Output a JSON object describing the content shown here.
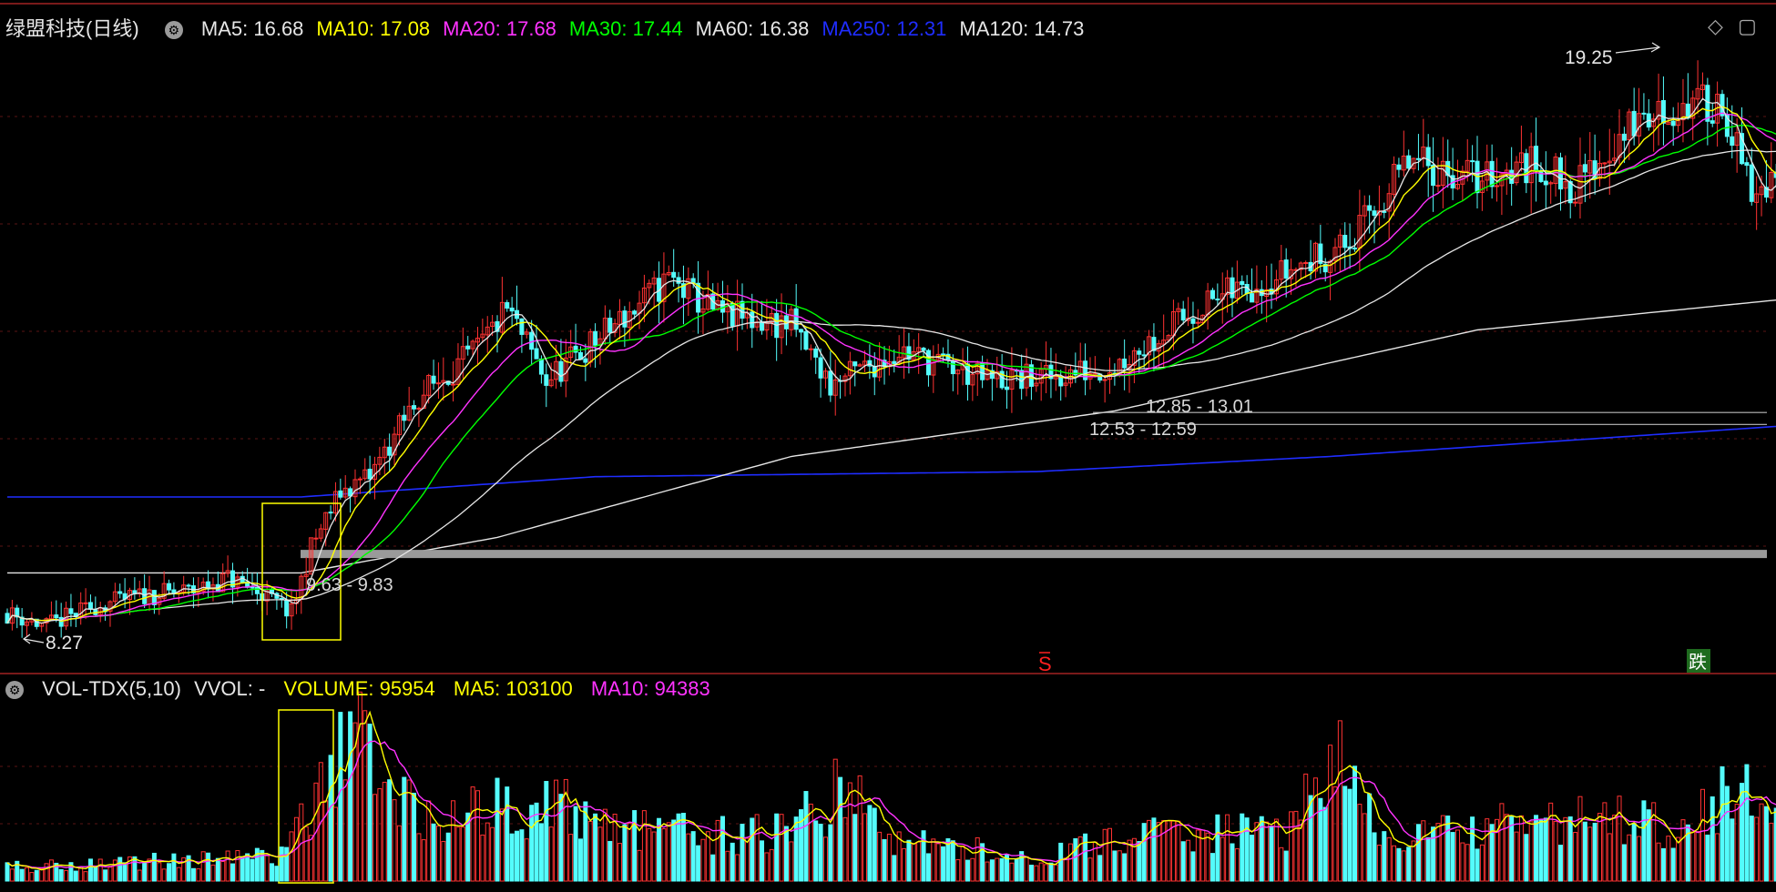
{
  "header": {
    "stock_title": "绿盟科技(日线)",
    "ma_values": [
      {
        "text": "MA5: 16.68",
        "color": "#e6e6e6"
      },
      {
        "text": "MA10: 17.08",
        "color": "#ffff00"
      },
      {
        "text": "MA20: 17.68",
        "color": "#ff33ff"
      },
      {
        "text": "MA30: 17.44",
        "color": "#00ff00"
      },
      {
        "text": "MA60: 16.38",
        "color": "#e6e6e6"
      },
      {
        "text": "MA250: 12.31",
        "color": "#1f2dff"
      },
      {
        "text": "MA120: 14.73",
        "color": "#e6e6e6"
      }
    ]
  },
  "volume_header": {
    "indicator": "VOL-TDX(5,10)",
    "vvol": "VVOL: -",
    "volume": "VOLUME: 95954",
    "ma5": "MA5: 103100",
    "ma10": "MA10: 94383"
  },
  "annotations": {
    "high_label": "19.25",
    "low_label": "8.27",
    "gap1": "9.63 - 9.83",
    "gap2": "12.85 - 13.01",
    "gap3": "12.53 - 12.59",
    "s_marker": "S",
    "die_marker": "跌"
  },
  "chart_data": {
    "type": "candlestick",
    "price_range": [
      7.5,
      20.0
    ],
    "colors": {
      "up": "#ff3232",
      "down": "#54fcfc",
      "ma5": "#e6e6e6",
      "ma10": "#ffff00",
      "ma20": "#ff33ff",
      "ma30": "#00ff00",
      "ma60": "#e6e6e6",
      "ma120": "#e6e6e6",
      "ma250": "#1f2dff"
    },
    "price_path": [
      [
        0,
        8.6
      ],
      [
        8,
        8.35
      ],
      [
        18,
        8.75
      ],
      [
        28,
        8.95
      ],
      [
        38,
        9.05
      ],
      [
        45,
        9.3
      ],
      [
        52,
        9.0
      ],
      [
        58,
        8.6
      ],
      [
        62,
        9.9
      ],
      [
        68,
        11.0
      ],
      [
        74,
        11.3
      ],
      [
        84,
        12.9
      ],
      [
        96,
        13.8
      ],
      [
        102,
        14.6
      ],
      [
        110,
        13.2
      ],
      [
        124,
        14.3
      ],
      [
        135,
        15.2
      ],
      [
        145,
        14.5
      ],
      [
        160,
        14.3
      ],
      [
        168,
        13.1
      ],
      [
        182,
        13.8
      ],
      [
        200,
        13.2
      ],
      [
        212,
        13.25
      ],
      [
        226,
        13.5
      ],
      [
        244,
        14.7
      ],
      [
        262,
        15.4
      ],
      [
        274,
        15.9
      ],
      [
        286,
        17.5
      ],
      [
        300,
        17.2
      ],
      [
        312,
        17.5
      ],
      [
        320,
        17.0
      ],
      [
        332,
        18.3
      ],
      [
        342,
        18.6
      ],
      [
        350,
        18.7
      ],
      [
        356,
        16.8
      ],
      [
        362,
        17.2
      ]
    ],
    "volume_path": [
      [
        0,
        12000
      ],
      [
        30,
        18000
      ],
      [
        55,
        22000
      ],
      [
        62,
        58000
      ],
      [
        70,
        150000
      ],
      [
        76,
        85000
      ],
      [
        90,
        50000
      ],
      [
        102,
        70000
      ],
      [
        112,
        65000
      ],
      [
        130,
        45000
      ],
      [
        145,
        40000
      ],
      [
        160,
        45000
      ],
      [
        170,
        80000
      ],
      [
        182,
        35000
      ],
      [
        195,
        28000
      ],
      [
        212,
        20000
      ],
      [
        226,
        38000
      ],
      [
        240,
        42000
      ],
      [
        262,
        45000
      ],
      [
        270,
        115000
      ],
      [
        280,
        38000
      ],
      [
        300,
        45000
      ],
      [
        320,
        55000
      ],
      [
        340,
        52000
      ],
      [
        362,
        95954
      ]
    ],
    "volume_range": [
      0,
      160000
    ],
    "moving_averages": {
      "ma250": [
        [
          0,
          10.9
        ],
        [
          60,
          10.9
        ],
        [
          120,
          11.3
        ],
        [
          210,
          11.4
        ],
        [
          270,
          11.7
        ],
        [
          362,
          12.3
        ]
      ],
      "ma120": [
        [
          0,
          9.4
        ],
        [
          60,
          9.4
        ],
        [
          100,
          10.1
        ],
        [
          160,
          11.7
        ],
        [
          226,
          12.6
        ],
        [
          300,
          14.2
        ],
        [
          362,
          14.8
        ]
      ]
    },
    "horizontal_levels": [
      9.8,
      12.8,
      13.0
    ]
  }
}
